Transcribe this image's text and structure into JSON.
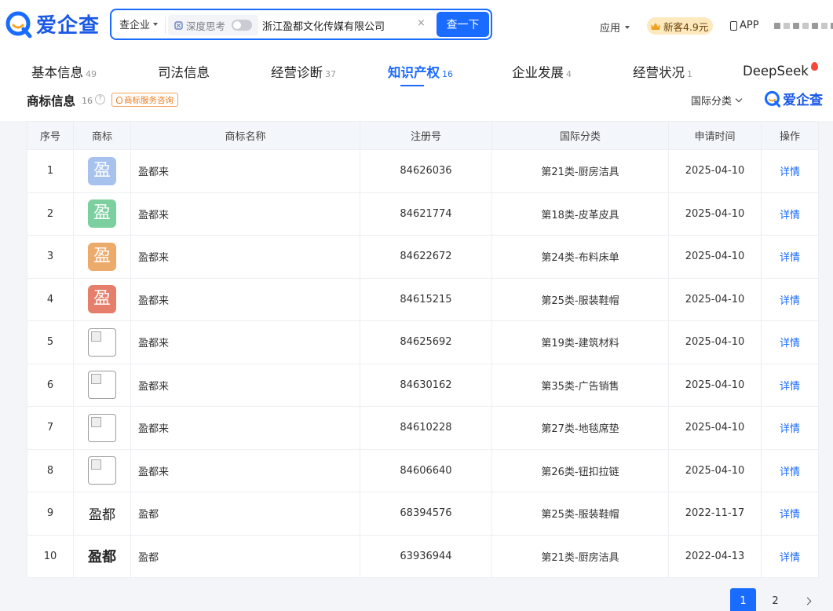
{
  "brand": {
    "name": "爱企查",
    "primary_color": "#1a6bff"
  },
  "search": {
    "scope": "查企业",
    "deep_think": "深度思考",
    "query": "浙江盈都文化传媒有限公司",
    "clear": "×",
    "button": "查一下"
  },
  "nav": {
    "apps": "应用",
    "vip": "新客4.9元",
    "app": "APP"
  },
  "tabs": [
    {
      "label": "基本信息",
      "count": "49"
    },
    {
      "label": "司法信息",
      "count": ""
    },
    {
      "label": "经营诊断",
      "count": "37"
    },
    {
      "label": "知识产权",
      "count": "16",
      "active": true
    },
    {
      "label": "企业发展",
      "count": "4"
    },
    {
      "label": "经营状况",
      "count": "1"
    },
    {
      "label": "DeepSeek",
      "count": ""
    }
  ],
  "section": {
    "title": "商标信息",
    "count": "16",
    "service_tag": "商标服务咨询",
    "filter": "国际分类",
    "brand_label": "爱企查"
  },
  "table": {
    "headers": [
      "序号",
      "商标",
      "商标名称",
      "注册号",
      "国际分类",
      "申请时间",
      "操作"
    ],
    "rows": [
      {
        "no": "1",
        "logo": {
          "kind": "box",
          "char": "盈",
          "color": "#a8c2ee"
        },
        "name": "盈都来",
        "reg": "84626036",
        "cls": "第21类-厨房洁具",
        "date": "2025-04-10",
        "action": "详情"
      },
      {
        "no": "2",
        "logo": {
          "kind": "box",
          "char": "盈",
          "color": "#7ccf9f"
        },
        "name": "盈都来",
        "reg": "84621774",
        "cls": "第18类-皮革皮具",
        "date": "2025-04-10",
        "action": "详情"
      },
      {
        "no": "3",
        "logo": {
          "kind": "box",
          "char": "盈",
          "color": "#ecaa6b"
        },
        "name": "盈都来",
        "reg": "84622672",
        "cls": "第24类-布料床单",
        "date": "2025-04-10",
        "action": "详情"
      },
      {
        "no": "4",
        "logo": {
          "kind": "box",
          "char": "盈",
          "color": "#e57e6b"
        },
        "name": "盈都来",
        "reg": "84615215",
        "cls": "第25类-服装鞋帽",
        "date": "2025-04-10",
        "action": "详情"
      },
      {
        "no": "5",
        "logo": {
          "kind": "broken"
        },
        "name": "盈都来",
        "reg": "84625692",
        "cls": "第19类-建筑材料",
        "date": "2025-04-10",
        "action": "详情"
      },
      {
        "no": "6",
        "logo": {
          "kind": "broken"
        },
        "name": "盈都来",
        "reg": "84630162",
        "cls": "第35类-广告销售",
        "date": "2025-04-10",
        "action": "详情"
      },
      {
        "no": "7",
        "logo": {
          "kind": "broken"
        },
        "name": "盈都来",
        "reg": "84610228",
        "cls": "第27类-地毯席垫",
        "date": "2025-04-10",
        "action": "详情"
      },
      {
        "no": "8",
        "logo": {
          "kind": "broken"
        },
        "name": "盈都来",
        "reg": "84606640",
        "cls": "第26类-钮扣拉链",
        "date": "2025-04-10",
        "action": "详情"
      },
      {
        "no": "9",
        "logo": {
          "kind": "text",
          "char": "盈都",
          "big": false
        },
        "name": "盈都",
        "reg": "68394576",
        "cls": "第25类-服装鞋帽",
        "date": "2022-11-17",
        "action": "详情"
      },
      {
        "no": "10",
        "logo": {
          "kind": "text",
          "char": "盈都",
          "big": true
        },
        "name": "盈都",
        "reg": "63936944",
        "cls": "第21类-厨房洁具",
        "date": "2022-04-13",
        "action": "详情"
      }
    ]
  },
  "pagination": {
    "pages": [
      "1",
      "2"
    ],
    "current": "1"
  }
}
